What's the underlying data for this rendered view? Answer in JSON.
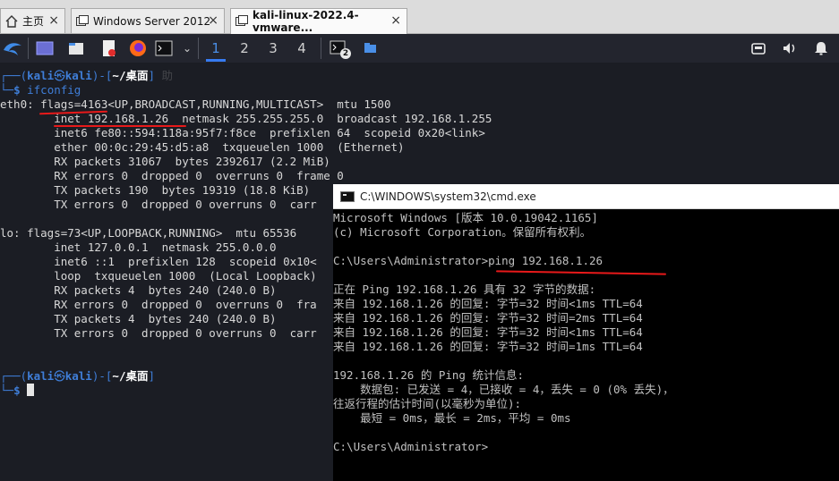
{
  "tabs": [
    {
      "label": "主页",
      "icon": "home-icon"
    },
    {
      "label": "Windows Server 2012",
      "icon": "vm-icon"
    },
    {
      "label": "kali-linux-2022.4-vmware...",
      "icon": "vm-icon"
    }
  ],
  "panel": {
    "workspaces": [
      "1",
      "2",
      "3",
      "4"
    ],
    "active_workspace": "1",
    "terminal_badge": "2"
  },
  "kali": {
    "prompt1": {
      "user": "kali",
      "at": "㉿",
      "host": "kali",
      "dir": "~/桌面",
      "watermark": "助"
    },
    "command1": "ifconfig",
    "output": [
      "eth0: flags=4163<UP,BROADCAST,RUNNING,MULTICAST>  mtu 1500",
      "        inet 192.168.1.26  netmask 255.255.255.0  broadcast 192.168.1.255",
      "        inet6 fe80::594:118a:95f7:f8ce  prefixlen 64  scopeid 0x20<link>",
      "        ether 00:0c:29:45:d5:a8  txqueuelen 1000  (Ethernet)",
      "        RX packets 31067  bytes 2392617 (2.2 MiB)",
      "        RX errors 0  dropped 0  overruns 0  frame 0",
      "        TX packets 190  bytes 19319 (18.8 KiB)",
      "        TX errors 0  dropped 0 overruns 0  carr",
      "",
      "lo: flags=73<UP,LOOPBACK,RUNNING>  mtu 65536",
      "        inet 127.0.0.1  netmask 255.0.0.0",
      "        inet6 ::1  prefixlen 128  scopeid 0x10<",
      "        loop  txqueuelen 1000  (Local Loopback)",
      "        RX packets 4  bytes 240 (240.0 B)",
      "        RX errors 0  dropped 0  overruns 0  fra",
      "        TX packets 4  bytes 240 (240.0 B)",
      "        TX errors 0  dropped 0 overruns 0  carr"
    ],
    "prompt2": {
      "user": "kali",
      "at": "㉿",
      "host": "kali",
      "dir": "~/桌面"
    }
  },
  "cmd": {
    "title": "C:\\WINDOWS\\system32\\cmd.exe",
    "lines": [
      "Microsoft Windows [版本 10.0.19042.1165]",
      "(c) Microsoft Corporation。保留所有权利。",
      "",
      "C:\\Users\\Administrator>ping 192.168.1.26",
      "",
      "正在 Ping 192.168.1.26 具有 32 字节的数据:",
      "来自 192.168.1.26 的回复: 字节=32 时间<1ms TTL=64",
      "来自 192.168.1.26 的回复: 字节=32 时间=2ms TTL=64",
      "来自 192.168.1.26 的回复: 字节=32 时间<1ms TTL=64",
      "来自 192.168.1.26 的回复: 字节=32 时间=1ms TTL=64",
      "",
      "192.168.1.26 的 Ping 统计信息:",
      "    数据包: 已发送 = 4，已接收 = 4，丢失 = 0 (0% 丢失)，",
      "往返行程的估计时间(以毫秒为单位):",
      "    最短 = 0ms，最长 = 2ms，平均 = 0ms",
      "",
      "C:\\Users\\Administrator>"
    ]
  }
}
